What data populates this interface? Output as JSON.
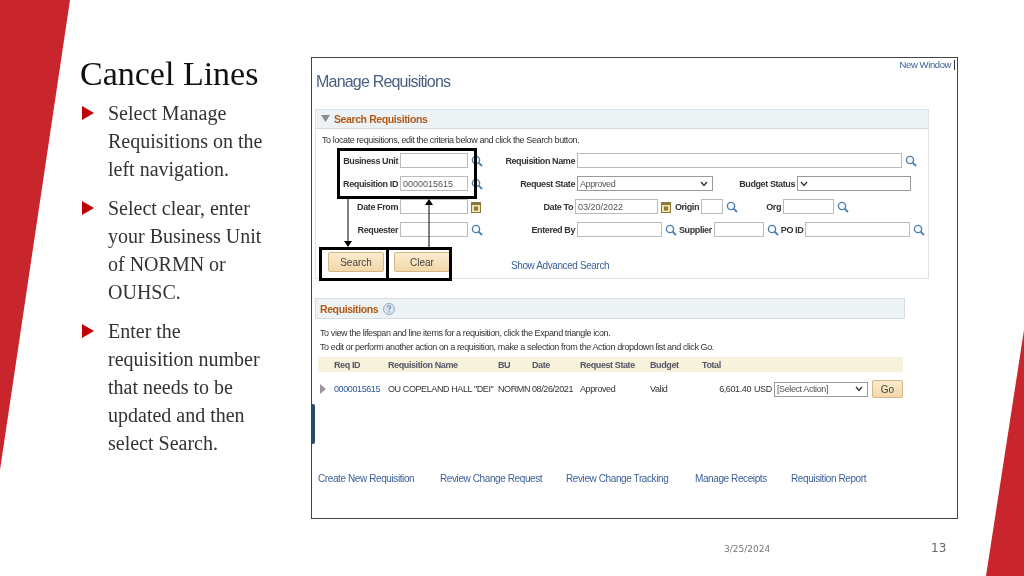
{
  "slide": {
    "title": "Cancel Lines",
    "bullets": [
      "Select Manage Requisitions on the left navigation.",
      "Select clear, enter your Business Unit of NORMN or OUHSC.",
      "Enter the requisition number that needs to be updated and then select Search."
    ],
    "date": "3/25/2024",
    "page": "13"
  },
  "screen": {
    "top_link": "New Window",
    "title": "Manage Requisitions",
    "search": {
      "heading": "Search Requisitions",
      "expanded": true,
      "instructions": "To locate requisitions, edit the criteria below and click the Search button.",
      "rows": [
        [
          {
            "label": "Business Unit",
            "kind": "lookup"
          },
          {
            "label": "Requisition Name",
            "kind": "lookup"
          }
        ],
        [
          {
            "label": "Requisition ID",
            "kind": "lookup",
            "value": "0000015615"
          },
          {
            "label": "Request State",
            "kind": "select",
            "value": "Approved"
          },
          null,
          {
            "label": "Budget Status",
            "kind": "select"
          }
        ],
        [
          {
            "label": "Date From",
            "kind": "date"
          },
          {
            "label": "Date To",
            "kind": "date",
            "value": "03/20/2022"
          },
          {
            "label": "Origin",
            "kind": "lookup"
          },
          {
            "label": "Org",
            "kind": "lookup"
          }
        ],
        [
          {
            "label": "Requester",
            "kind": "lookup"
          },
          {
            "label": "Entered By",
            "kind": "lookup"
          },
          {
            "label": "Supplier",
            "kind": "lookup"
          },
          {
            "label": "PO ID",
            "kind": "lookup"
          }
        ]
      ],
      "buttons": [
        "Search",
        "Clear"
      ],
      "advanced_link": "Show Advanced Search"
    },
    "requisitions": {
      "heading": "Requisitions",
      "notes": [
        "To view the lifespan and line items for a requisition, click the Expand triangle icon.",
        "To edit or perform another action on a requisition, make a selection from the Action dropdown list and click Go."
      ],
      "columns": [
        "Req ID",
        "Requisition Name",
        "BU",
        "Date",
        "Request State",
        "Budget",
        "Total"
      ],
      "rows": [
        {
          "expanded": false,
          "req_id": "0000015615",
          "name": "OU COPELAND HALL \"DEI\"",
          "bu": "NORMN",
          "date": "08/26/2021",
          "state": "Approved",
          "budget": "Valid",
          "total": "6,601.40",
          "currency": "USD",
          "action": "[Select Action]",
          "go": "Go"
        }
      ]
    },
    "links": [
      "Create New Requisition",
      "Review Change Request",
      "Review Change Tracking",
      "Manage Receipts",
      "Requisition Report"
    ]
  }
}
